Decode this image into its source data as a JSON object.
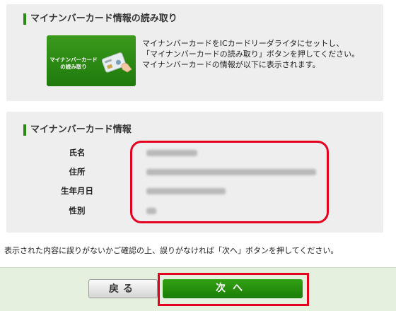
{
  "read_section": {
    "title": "マイナンバーカード情報の読み取り",
    "card_button_label": "マイナンバーカード\nの読み取り",
    "instructions": [
      "マイナンバーカードをICカードリーダライタにセットし、",
      "「マイナンバーカードの読み取り」ボタンを押してください。",
      "マイナンバーカードの情報が以下に表示されます。"
    ]
  },
  "info_section": {
    "title": "マイナンバーカード情報",
    "rows": [
      {
        "label": "氏名"
      },
      {
        "label": "住所"
      },
      {
        "label": "生年月日"
      },
      {
        "label": "性別"
      }
    ]
  },
  "confirm_text": "表示された内容に誤りがないかご確認の上、誤りがなければ「次へ」ボタンを押してください。",
  "buttons": {
    "back": "戻る",
    "next": "次へ"
  },
  "colors": {
    "accent_green": "#2b8a13",
    "highlight_red": "#e6001f",
    "panel_gray": "#eeeeee",
    "footer_green": "#e6f0df"
  }
}
